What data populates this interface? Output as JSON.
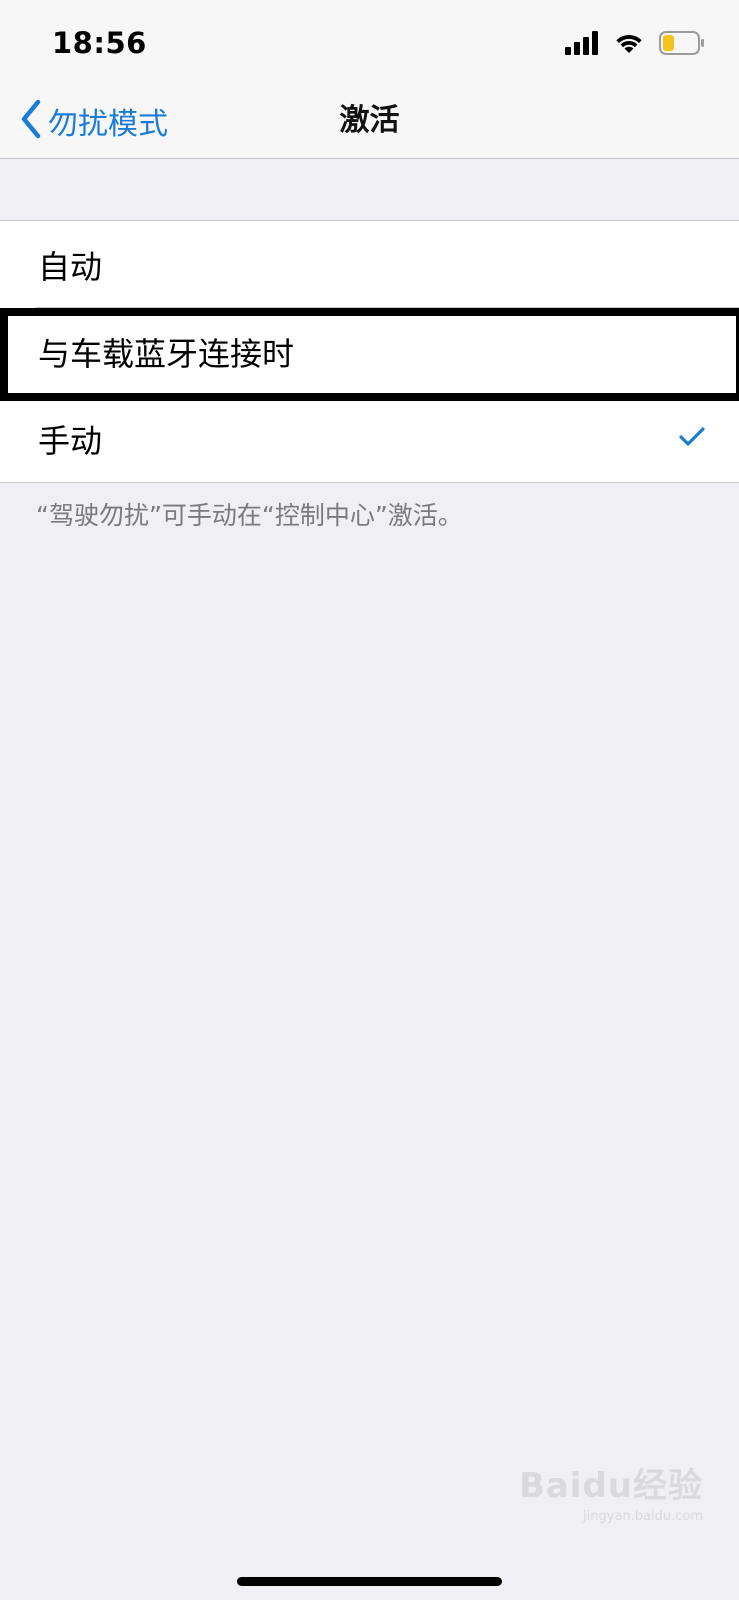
{
  "status_bar": {
    "time": "18:56"
  },
  "nav": {
    "back_label": "勿扰模式",
    "title": "激活"
  },
  "options": [
    {
      "label": "自动",
      "selected": false
    },
    {
      "label": "与车载蓝牙连接时",
      "selected": false
    },
    {
      "label": "手动",
      "selected": true
    }
  ],
  "footer_note": "“驾驶勿扰”可手动在“控制中心”激活。",
  "watermark": {
    "main": "Baidu经验",
    "sub": "jingyan.baidu.com"
  },
  "colors": {
    "accent": "#1a7cd6",
    "battery": "#f2c41c",
    "background": "#efeff4"
  }
}
